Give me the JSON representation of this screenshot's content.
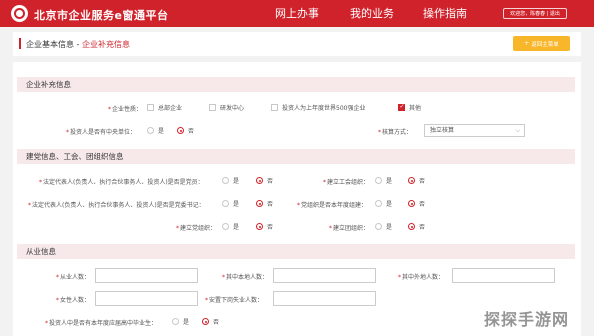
{
  "header": {
    "site_title": "北京市企业服务e窗通平台",
    "nav": [
      "网上办事",
      "我的业务",
      "操作指南"
    ],
    "user_links": "欢迎您，陈春春 | 退出"
  },
  "breadcrumb": {
    "prefix": "企业基本信息 - ",
    "current": "企业补充信息",
    "return_plus": "+",
    "return_label": "返回主菜单"
  },
  "section_supplement": {
    "title": "企业补充信息",
    "enterprise_type_label": "企业性质：",
    "enterprise_type_options": [
      {
        "label": "总部企业",
        "checked": false
      },
      {
        "label": "研发中心",
        "checked": false
      },
      {
        "label": "投资人为上年度世界500强企业",
        "checked": false
      },
      {
        "label": "其他",
        "checked": true
      }
    ],
    "central_unit_label": "投资人是否有中央单位：",
    "central_unit_yes": "是",
    "central_unit_no": "否",
    "accounting_label": "核算方式：",
    "accounting_value": "独立核算"
  },
  "section_party": {
    "title": "建党信息、工会、团组织信息",
    "rep_party_label": "法定代表人(负责人、执行合伙事务人、投资人)是否是党员：",
    "rep_secretary_label": "法定代表人(负责人、执行合伙事务人、投资人)是否是党委书记：",
    "union_label": "建立工会组织：",
    "party_next_year_label": "党组织是否本年度组建：",
    "party_org_label": "建立党组织：",
    "youth_org_label": "建立团组织：",
    "yes": "是",
    "no": "否"
  },
  "section_staff": {
    "title": "从业信息",
    "employees_label": "从业人数：",
    "local_label": "其中本地人数：",
    "nonlocal_label": "其中外地人数：",
    "female_label": "女性人数：",
    "laidoff_label": "安置下岗失业人数：",
    "graduates_label": "投资人中是否有本年度应届高中毕业生：",
    "yes": "是",
    "no": "否"
  },
  "watermark": "探探手游网",
  "colors": {
    "brand": "#d0222b",
    "accent": "#f8b62b",
    "section_bg": "#f7e9ea"
  }
}
